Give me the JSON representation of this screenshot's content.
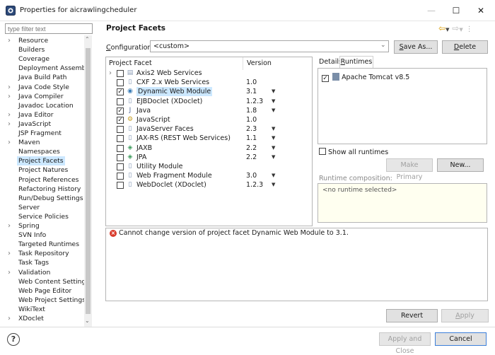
{
  "window": {
    "title": "Properties for aicrawlingcheduler",
    "minimize": "—",
    "maximize": "☐",
    "close": "✕"
  },
  "sidebar": {
    "filter_placeholder": "type filter text",
    "items": [
      {
        "label": "Resource",
        "expandable": true
      },
      {
        "label": "Builders",
        "expandable": false
      },
      {
        "label": "Coverage",
        "expandable": false
      },
      {
        "label": "Deployment Assembly",
        "expandable": false
      },
      {
        "label": "Java Build Path",
        "expandable": false
      },
      {
        "label": "Java Code Style",
        "expandable": true
      },
      {
        "label": "Java Compiler",
        "expandable": true
      },
      {
        "label": "Javadoc Location",
        "expandable": false
      },
      {
        "label": "Java Editor",
        "expandable": true
      },
      {
        "label": "JavaScript",
        "expandable": true
      },
      {
        "label": "JSP Fragment",
        "expandable": false
      },
      {
        "label": "Maven",
        "expandable": true
      },
      {
        "label": "Namespaces",
        "expandable": false
      },
      {
        "label": "Project Facets",
        "expandable": false,
        "selected": true
      },
      {
        "label": "Project Natures",
        "expandable": false
      },
      {
        "label": "Project References",
        "expandable": false
      },
      {
        "label": "Refactoring History",
        "expandable": false
      },
      {
        "label": "Run/Debug Settings",
        "expandable": false
      },
      {
        "label": "Server",
        "expandable": false
      },
      {
        "label": "Service Policies",
        "expandable": false
      },
      {
        "label": "Spring",
        "expandable": true
      },
      {
        "label": "SVN Info",
        "expandable": false
      },
      {
        "label": "Targeted Runtimes",
        "expandable": false
      },
      {
        "label": "Task Repository",
        "expandable": true
      },
      {
        "label": "Task Tags",
        "expandable": false
      },
      {
        "label": "Validation",
        "expandable": true
      },
      {
        "label": "Web Content Settings",
        "expandable": false
      },
      {
        "label": "Web Page Editor",
        "expandable": false
      },
      {
        "label": "Web Project Settings",
        "expandable": false
      },
      {
        "label": "WikiText",
        "expandable": false
      },
      {
        "label": "XDoclet",
        "expandable": true
      }
    ]
  },
  "page": {
    "title": "Project Facets",
    "configuration_label": "Configuration:",
    "configuration_value": "<custom>",
    "save_as": "Save As...",
    "delete": "Delete"
  },
  "facets": {
    "col_facet": "Project Facet",
    "col_version": "Version",
    "rows": [
      {
        "name": "Axis2 Web Services",
        "version": "",
        "checked": false,
        "icon": "folder",
        "expander": true,
        "dropdown": false
      },
      {
        "name": "CXF 2.x Web Services",
        "version": "1.0",
        "checked": false,
        "icon": "page",
        "expander": false,
        "dropdown": false
      },
      {
        "name": "Dynamic Web Module",
        "version": "3.1",
        "checked": true,
        "icon": "globe",
        "expander": false,
        "dropdown": true,
        "selected": true
      },
      {
        "name": "EJBDoclet (XDoclet)",
        "version": "1.2.3",
        "checked": false,
        "icon": "page",
        "expander": false,
        "dropdown": true
      },
      {
        "name": "Java",
        "version": "1.8",
        "checked": true,
        "icon": "java",
        "expander": false,
        "dropdown": true
      },
      {
        "name": "JavaScript",
        "version": "1.0",
        "checked": true,
        "icon": "js",
        "expander": false,
        "dropdown": false
      },
      {
        "name": "JavaServer Faces",
        "version": "2.3",
        "checked": false,
        "icon": "page",
        "expander": false,
        "dropdown": true
      },
      {
        "name": "JAX-RS (REST Web Services)",
        "version": "1.1",
        "checked": false,
        "icon": "page",
        "expander": false,
        "dropdown": true
      },
      {
        "name": "JAXB",
        "version": "2.2",
        "checked": false,
        "icon": "jaxb",
        "expander": false,
        "dropdown": true
      },
      {
        "name": "JPA",
        "version": "2.2",
        "checked": false,
        "icon": "jaxb",
        "expander": false,
        "dropdown": true
      },
      {
        "name": "Utility Module",
        "version": "",
        "checked": false,
        "icon": "page",
        "expander": false,
        "dropdown": false
      },
      {
        "name": "Web Fragment Module",
        "version": "3.0",
        "checked": false,
        "icon": "page",
        "expander": false,
        "dropdown": true
      },
      {
        "name": "WebDoclet (XDoclet)",
        "version": "1.2.3",
        "checked": false,
        "icon": "page",
        "expander": false,
        "dropdown": true
      }
    ]
  },
  "runtimes": {
    "tab_details": "Details",
    "tab_runtimes": "Runtimes",
    "item": "Apache Tomcat v8.5",
    "item_checked": true,
    "show_all": "Show all runtimes",
    "make_primary": "Make Primary",
    "new": "New...",
    "composition_label": "Runtime composition:",
    "composition_value": "<no runtime selected>"
  },
  "message": {
    "text": "Cannot change version of project facet Dynamic Web Module to 3.1."
  },
  "buttons": {
    "revert": "Revert",
    "apply": "Apply",
    "apply_close": "Apply and Close",
    "cancel": "Cancel"
  },
  "colors": {
    "selection": "#cce8ff",
    "error": "#d93a2b",
    "nav_arrows": "#d99a00"
  }
}
